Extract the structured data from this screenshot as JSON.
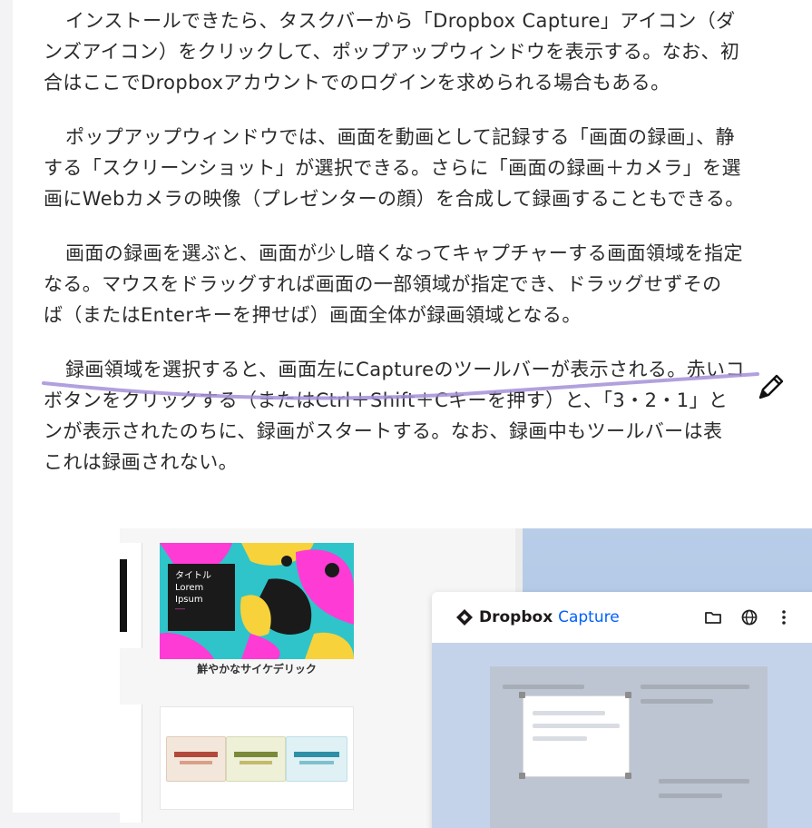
{
  "article": {
    "paragraphs": [
      {
        "lines": [
          "インストールできたら、タスクバーから「Dropbox Capture」アイコン（ダ",
          "ンズアイコン）をクリックして、ポップアップウィンドウを表示する。なお、初",
          "合はここでDropboxアカウントでのログインを求められる場合もある。"
        ]
      },
      {
        "lines": [
          "ポップアップウィンドウでは、画面を動画として記録する「画面の録画」、静",
          "する「スクリーンショット」が選択できる。さらに「画面の録画＋カメラ」を選",
          "画にWebカメラの映像（プレゼンターの顔）を合成して録画することもできる。"
        ]
      },
      {
        "lines": [
          "画面の録画を選ぶと、画面が少し暗くなってキャプチャーする画面領域を指定",
          "なる。マウスをドラッグすれば画面の一部領域が指定でき、ドラッグせずその",
          "ば（またはEnterキーを押せば）画面全体が録画領域となる。"
        ]
      },
      {
        "lines": [
          "録画領域を選択すると、画面左にCaptureのツールバーが表示される。赤いコ",
          "ボタンをクリックする（またはCtrl＋Shift＋Cキーを押す）と、「3・2・1」と",
          "ンが表示されたのちに、録画がスタートする。なお、録画中もツールバーは表",
          "これは録画されない。"
        ]
      }
    ]
  },
  "annotation": {
    "underline_color": "#a58fd8",
    "tool_icon": "pencil-icon"
  },
  "figure": {
    "template_card": {
      "title_lines": [
        "タイトル",
        "Lorem",
        "Ipsum"
      ],
      "caption": "鮮やかなサイケデリック"
    },
    "dropbox_window": {
      "brand": "Dropbox",
      "product": "Capture",
      "brand_color": "#1e1919",
      "product_color": "#0061fe",
      "header_icons": [
        "folder-icon",
        "globe-icon",
        "more-vertical-icon"
      ]
    }
  }
}
